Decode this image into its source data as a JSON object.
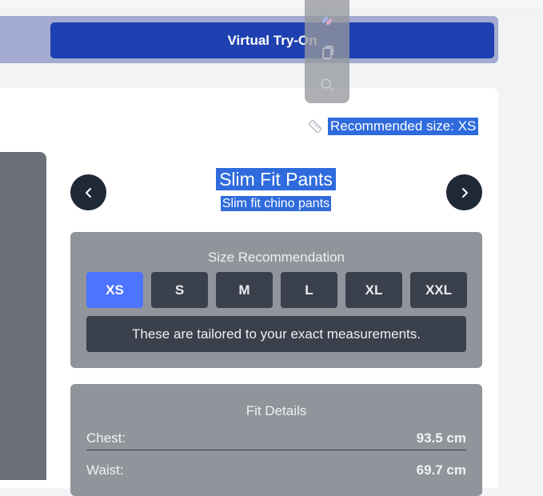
{
  "toolbar": {
    "virtual_try_on_label": "Virtual Try-On"
  },
  "recommendation": {
    "text": "Recommended size: XS",
    "icon": "ruler-icon"
  },
  "product": {
    "title": "Slim Fit Pants",
    "subtitle": "Slim fit chino pants"
  },
  "size_recommendation": {
    "heading": "Size Recommendation",
    "sizes": [
      "XS",
      "S",
      "M",
      "L",
      "XL",
      "XXL"
    ],
    "selected": "XS",
    "note": "These are tailored to your exact measurements."
  },
  "fit_details": {
    "heading": "Fit Details",
    "rows": [
      {
        "label": "Chest:",
        "value": "93.5 cm"
      },
      {
        "label": "Waist:",
        "value": "69.7 cm"
      }
    ]
  },
  "floating_toolbar": {
    "icons": [
      "copilot-icon",
      "copy-icon",
      "search-icon"
    ]
  },
  "colors": {
    "accent": "#1e40b0",
    "selection": "#2f6bdc",
    "selected_size": "#4c74ff",
    "dark": "#1f2937"
  }
}
